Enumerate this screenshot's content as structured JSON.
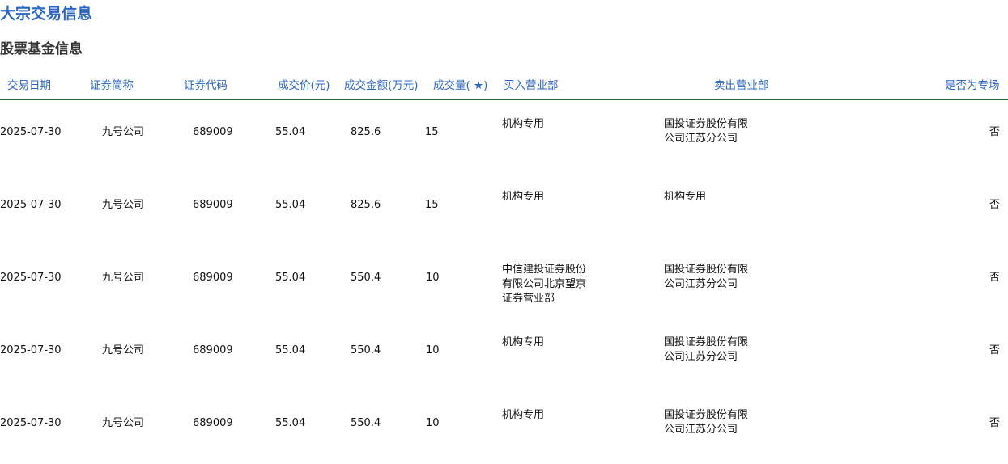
{
  "page_title": "大宗交易信息",
  "section_title": "股票基金信息",
  "table": {
    "headers": [
      "交易日期",
      "证券简称",
      "证券代码",
      "成交价(元)",
      "成交金额(万元)",
      "成交量( ★)",
      "买入营业部",
      "卖出营业部",
      "是否为专场"
    ],
    "rows": [
      {
        "date": "2025-07-30",
        "name": "九号公司",
        "code": "689009",
        "price": "55.04",
        "amount": "825.6",
        "volume": "15",
        "buy_line1": "机构专用",
        "buy_line2": "",
        "buy_line3": "",
        "sell_line1": "国投证券股份有限",
        "sell_line2": "公司江苏分公司",
        "special": "否"
      },
      {
        "date": "2025-07-30",
        "name": "九号公司",
        "code": "689009",
        "price": "55.04",
        "amount": "825.6",
        "volume": "15",
        "buy_line1": "机构专用",
        "buy_line2": "",
        "buy_line3": "",
        "sell_line1": "机构专用",
        "sell_line2": "",
        "special": "否"
      },
      {
        "date": "2025-07-30",
        "name": "九号公司",
        "code": "689009",
        "price": "55.04",
        "amount": "550.4",
        "volume": "10",
        "buy_line1": "中信建投证券股份",
        "buy_line2": "有限公司北京望京",
        "buy_line3": "证券营业部",
        "sell_line1": "国投证券股份有限",
        "sell_line2": "公司江苏分公司",
        "special": "否"
      },
      {
        "date": "2025-07-30",
        "name": "九号公司",
        "code": "689009",
        "price": "55.04",
        "amount": "550.4",
        "volume": "10",
        "buy_line1": "机构专用",
        "buy_line2": "",
        "buy_line3": "",
        "sell_line1": "国投证券股份有限",
        "sell_line2": "公司江苏分公司",
        "special": "否"
      },
      {
        "date": "2025-07-30",
        "name": "九号公司",
        "code": "689009",
        "price": "55.04",
        "amount": "550.4",
        "volume": "10",
        "buy_line1": "机构专用",
        "buy_line2": "",
        "buy_line3": "",
        "sell_line1": "国投证券股份有限",
        "sell_line2": "公司江苏分公司",
        "special": "否"
      }
    ]
  }
}
